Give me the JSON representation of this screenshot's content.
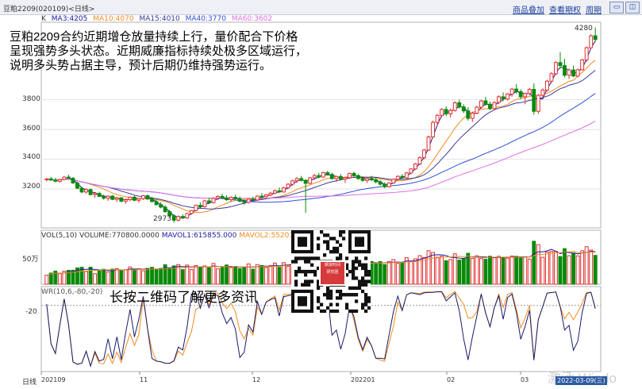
{
  "window": {
    "title": "豆粕2209(020109)<日线>"
  },
  "toolbar": {
    "overlay_label": "商品叠加",
    "history_label": "查看期权",
    "period_label": "周期"
  },
  "ma_legend": {
    "k": "K",
    "ma3": "MA3:4205",
    "ma10": "MA10:4070",
    "ma15": "MA15:4010",
    "ma40": "MA40:3770",
    "ma60": "MA60:3602"
  },
  "colors": {
    "up": "#e03030",
    "down": "#0a8a0a",
    "ma3": "#1a1aa0",
    "ma10": "#f08c1e",
    "ma15": "#3a3a9a",
    "ma40": "#3050d8",
    "ma60": "#e070e0",
    "grid": "#e2e2e2"
  },
  "overlay": {
    "line1": "豆粕2209合约近期增仓放量持续上行，量价配合下价格",
    "line2": "呈现强势多头状态。近期威廉指标持续处极多区域运行，",
    "line3": "说明多头势占据主导，预计后期仍维持强势运行。"
  },
  "price_axis": {
    "ticks": [
      "3800",
      "3600",
      "3400",
      "3200"
    ],
    "high_label": "4280",
    "low_label": "2973"
  },
  "volume": {
    "legend_vol": "VOL(5,10)",
    "legend_volume": "VOLUME:770800.0000",
    "legend_mavol1": "MAVOL1:615855.000",
    "legend_mavol2": "MAVOL2:552019.00",
    "axis_label": "50万"
  },
  "wr": {
    "legend": "WR(10,6,-80,-20)",
    "axis_label": "-20"
  },
  "promo": {
    "long_press": "长按二维码了解更多资讯",
    "qr_logo_line1": "期货时间",
    "qr_logo_line2": "研究团"
  },
  "x_axis": {
    "label": "日线",
    "ticks": [
      "202109",
      "11",
      "12",
      "202201",
      "02",
      "03"
    ],
    "date_box": "2022-03-09(三)"
  },
  "watermark": "激活 Windo",
  "chart_data": {
    "type": "candlestick",
    "y_range": [
      2960,
      4300
    ],
    "ohlc": [
      [
        3262,
        3272,
        3250,
        3268
      ],
      [
        3268,
        3282,
        3255,
        3260
      ],
      [
        3260,
        3275,
        3245,
        3252
      ],
      [
        3252,
        3270,
        3242,
        3264
      ],
      [
        3264,
        3285,
        3258,
        3280
      ],
      [
        3280,
        3296,
        3268,
        3272
      ],
      [
        3272,
        3280,
        3235,
        3240
      ],
      [
        3240,
        3248,
        3200,
        3205
      ],
      [
        3205,
        3215,
        3172,
        3180
      ],
      [
        3180,
        3205,
        3168,
        3196
      ],
      [
        3196,
        3202,
        3158,
        3162
      ],
      [
        3162,
        3178,
        3140,
        3170
      ],
      [
        3170,
        3182,
        3146,
        3150
      ],
      [
        3150,
        3162,
        3128,
        3138
      ],
      [
        3138,
        3158,
        3120,
        3152
      ],
      [
        3152,
        3160,
        3125,
        3130
      ],
      [
        3130,
        3148,
        3112,
        3140
      ],
      [
        3140,
        3146,
        3110,
        3118
      ],
      [
        3118,
        3135,
        3100,
        3128
      ],
      [
        3128,
        3150,
        3118,
        3145
      ],
      [
        3145,
        3156,
        3118,
        3124
      ],
      [
        3124,
        3140,
        3108,
        3135
      ],
      [
        3135,
        3160,
        3125,
        3155
      ],
      [
        3155,
        3164,
        3128,
        3132
      ],
      [
        3132,
        3148,
        3110,
        3115
      ],
      [
        3115,
        3128,
        3088,
        3095
      ],
      [
        3095,
        3110,
        3070,
        3078
      ],
      [
        3078,
        3090,
        3040,
        3048
      ],
      [
        3048,
        3058,
        3010,
        3020
      ],
      [
        3020,
        3030,
        2973,
        2990
      ],
      [
        2990,
        3022,
        2982,
        3015
      ],
      [
        3015,
        3030,
        2998,
        3005
      ],
      [
        3005,
        3040,
        3000,
        3035
      ],
      [
        3035,
        3060,
        3028,
        3055
      ],
      [
        3055,
        3095,
        3050,
        3090
      ],
      [
        3090,
        3110,
        3072,
        3080
      ],
      [
        3080,
        3128,
        3075,
        3120
      ],
      [
        3120,
        3140,
        3100,
        3108
      ],
      [
        3108,
        3145,
        3102,
        3138
      ],
      [
        3138,
        3158,
        3128,
        3150
      ],
      [
        3150,
        3168,
        3135,
        3140
      ],
      [
        3140,
        3158,
        3120,
        3128
      ],
      [
        3128,
        3150,
        3112,
        3144
      ],
      [
        3144,
        3162,
        3130,
        3135
      ],
      [
        3135,
        3150,
        3110,
        3118
      ],
      [
        3118,
        3130,
        3095,
        3110
      ],
      [
        3110,
        3138,
        3102,
        3132
      ],
      [
        3132,
        3148,
        3118,
        3126
      ],
      [
        3126,
        3158,
        3120,
        3152
      ],
      [
        3152,
        3172,
        3140,
        3148
      ],
      [
        3148,
        3166,
        3134,
        3160
      ],
      [
        3160,
        3182,
        3150,
        3172
      ],
      [
        3172,
        3196,
        3165,
        3188
      ],
      [
        3188,
        3210,
        3172,
        3180
      ],
      [
        3180,
        3215,
        3175,
        3208
      ],
      [
        3208,
        3240,
        3200,
        3232
      ],
      [
        3232,
        3262,
        3222,
        3255
      ],
      [
        3255,
        3280,
        3240,
        3270
      ],
      [
        3270,
        3288,
        3250,
        3258
      ],
      [
        3258,
        3266,
        3040,
        3238
      ],
      [
        3238,
        3280,
        3232,
        3275
      ],
      [
        3275,
        3302,
        3262,
        3290
      ],
      [
        3290,
        3308,
        3270,
        3280
      ],
      [
        3280,
        3316,
        3275,
        3310
      ],
      [
        3310,
        3322,
        3290,
        3298
      ],
      [
        3298,
        3310,
        3262,
        3270
      ],
      [
        3270,
        3290,
        3248,
        3284
      ],
      [
        3284,
        3300,
        3262,
        3266
      ],
      [
        3266,
        3282,
        3240,
        3276
      ],
      [
        3276,
        3310,
        3268,
        3305
      ],
      [
        3305,
        3316,
        3282,
        3290
      ],
      [
        3290,
        3300,
        3262,
        3270
      ],
      [
        3270,
        3284,
        3248,
        3258
      ],
      [
        3258,
        3276,
        3240,
        3270
      ],
      [
        3270,
        3288,
        3252,
        3262
      ],
      [
        3262,
        3278,
        3238,
        3248
      ],
      [
        3248,
        3260,
        3222,
        3232
      ],
      [
        3232,
        3245,
        3205,
        3215
      ],
      [
        3215,
        3245,
        3210,
        3240
      ],
      [
        3240,
        3272,
        3235,
        3265
      ],
      [
        3265,
        3292,
        3258,
        3285
      ],
      [
        3285,
        3300,
        3268,
        3275
      ],
      [
        3275,
        3315,
        3270,
        3308
      ],
      [
        3308,
        3340,
        3300,
        3335
      ],
      [
        3335,
        3375,
        3328,
        3368
      ],
      [
        3368,
        3420,
        3360,
        3410
      ],
      [
        3410,
        3470,
        3400,
        3462
      ],
      [
        3462,
        3560,
        3455,
        3550
      ],
      [
        3550,
        3660,
        3545,
        3648
      ],
      [
        3648,
        3705,
        3622,
        3695
      ],
      [
        3695,
        3745,
        3680,
        3735
      ],
      [
        3735,
        3755,
        3690,
        3705
      ],
      [
        3705,
        3740,
        3680,
        3728
      ],
      [
        3728,
        3790,
        3720,
        3780
      ],
      [
        3780,
        3800,
        3740,
        3752
      ],
      [
        3752,
        3770,
        3710,
        3725
      ],
      [
        3725,
        3750,
        3660,
        3675
      ],
      [
        3675,
        3720,
        3650,
        3710
      ],
      [
        3710,
        3760,
        3702,
        3750
      ],
      [
        3750,
        3800,
        3740,
        3792
      ],
      [
        3792,
        3820,
        3760,
        3770
      ],
      [
        3770,
        3788,
        3730,
        3740
      ],
      [
        3740,
        3790,
        3732,
        3782
      ],
      [
        3782,
        3830,
        3770,
        3820
      ],
      [
        3820,
        3850,
        3790,
        3805
      ],
      [
        3805,
        3845,
        3795,
        3838
      ],
      [
        3838,
        3880,
        3820,
        3872
      ],
      [
        3872,
        3905,
        3840,
        3855
      ],
      [
        3855,
        3870,
        3805,
        3820
      ],
      [
        3820,
        3850,
        3770,
        3842
      ],
      [
        3842,
        3880,
        3830,
        3870
      ],
      [
        3870,
        3910,
        3700,
        3722
      ],
      [
        3722,
        3840,
        3705,
        3830
      ],
      [
        3830,
        3880,
        3818,
        3865
      ],
      [
        3865,
        3935,
        3855,
        3925
      ],
      [
        3925,
        3985,
        3912,
        3975
      ],
      [
        3975,
        4060,
        3965,
        4050
      ],
      [
        4050,
        4120,
        4010,
        4030
      ],
      [
        4030,
        4075,
        3950,
        3965
      ],
      [
        3965,
        4010,
        3940,
        4000
      ],
      [
        4000,
        4030,
        3952,
        3960
      ],
      [
        3960,
        4010,
        3950,
        4002
      ],
      [
        4002,
        4075,
        3995,
        4068
      ],
      [
        4068,
        4160,
        4055,
        4150
      ],
      [
        4150,
        4240,
        4140,
        4230
      ],
      [
        4230,
        4286,
        4190,
        4205
      ]
    ],
    "volume_scale_max": 1000000
  }
}
